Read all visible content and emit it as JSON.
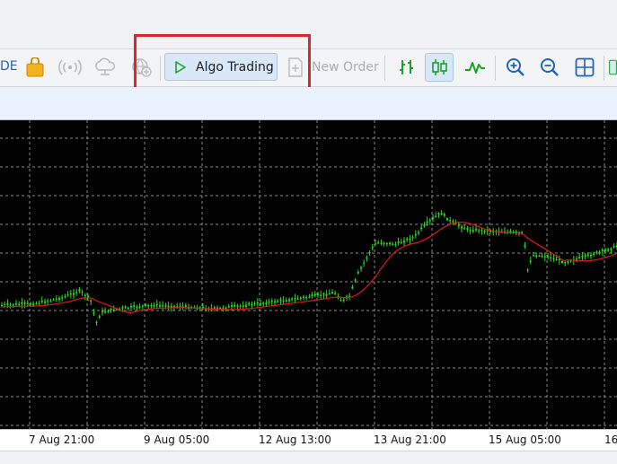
{
  "toolbar": {
    "left_fragment": "DE",
    "algo_trading_label": "Algo Trading",
    "new_order_label": "New Order"
  },
  "time_axis": {
    "labels": [
      "7 Aug 21:00",
      "9 Aug 05:00",
      "12 Aug 13:00",
      "13 Aug 21:00",
      "15 Aug 05:00",
      "16"
    ]
  },
  "colors": {
    "chart_bg": "#000000",
    "candles": "#27e01b",
    "moving_average": "#e01818",
    "grid": "#8a8a8a",
    "highlight": "#e0242c"
  }
}
